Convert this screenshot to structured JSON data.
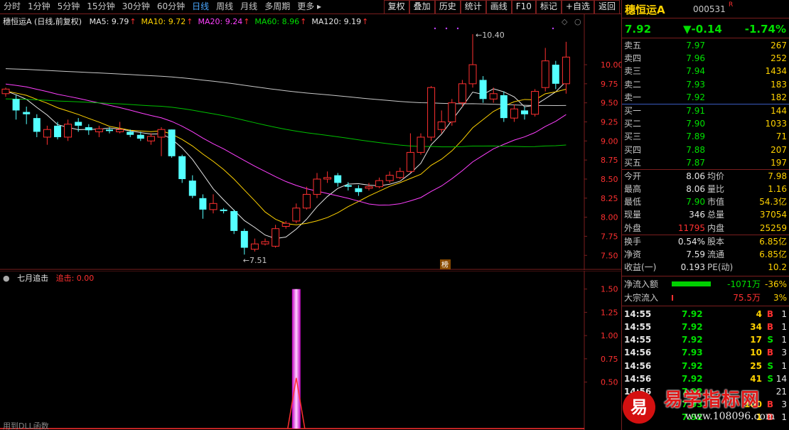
{
  "toolbar": {
    "periods": [
      "分时",
      "1分钟",
      "5分钟",
      "15分钟",
      "30分钟",
      "60分钟",
      "日线",
      "周线",
      "月线",
      "多周期",
      "更多"
    ],
    "active_period": "日线",
    "buttons": [
      "复权",
      "叠加",
      "历史",
      "统计",
      "画线",
      "F10",
      "标记",
      "+自选",
      "返回"
    ]
  },
  "main_legend": {
    "title": "穗恒运A (日线,前复权)",
    "ma": [
      {
        "label": "MA5: 9.79",
        "color": "#e6e6e6"
      },
      {
        "label": "MA10: 9.72",
        "color": "#ffd200"
      },
      {
        "label": "MA20: 9.24",
        "color": "#ff40ff"
      },
      {
        "label": "MA60: 8.96",
        "color": "#00e000"
      },
      {
        "label": "MA120: 9.19",
        "color": "#e6e6e6"
      }
    ]
  },
  "chart_data": [
    {
      "type": "candlestick",
      "y_ticks": [
        7.5,
        7.75,
        8.0,
        8.25,
        8.5,
        8.75,
        9.0,
        9.25,
        9.5,
        9.75,
        10.0
      ],
      "ylim": [
        7.4,
        10.55
      ],
      "annotations": [
        {
          "label": "10.40",
          "kind": "high"
        },
        {
          "label": "7.51",
          "kind": "low"
        },
        {
          "label": "榜",
          "kind": "event"
        }
      ],
      "candles": [
        {
          "o": 9.62,
          "c": 9.68,
          "h": 9.7,
          "l": 9.58
        },
        {
          "o": 9.55,
          "c": 9.4,
          "h": 9.6,
          "l": 9.28
        },
        {
          "o": 9.38,
          "c": 9.35,
          "h": 9.45,
          "l": 9.22
        },
        {
          "o": 9.3,
          "c": 9.12,
          "h": 9.35,
          "l": 9.05
        },
        {
          "o": 9.05,
          "c": 9.15,
          "h": 9.2,
          "l": 8.95
        },
        {
          "o": 9.2,
          "c": 9.05,
          "h": 9.25,
          "l": 9.02
        },
        {
          "o": 9.05,
          "c": 9.22,
          "h": 9.28,
          "l": 9.0
        },
        {
          "o": 9.25,
          "c": 9.2,
          "h": 9.3,
          "l": 9.12
        },
        {
          "o": 9.18,
          "c": 9.14,
          "h": 9.22,
          "l": 9.08
        },
        {
          "o": 9.12,
          "c": 9.16,
          "h": 9.2,
          "l": 9.05
        },
        {
          "o": 9.15,
          "c": 9.13,
          "h": 9.18,
          "l": 9.1
        },
        {
          "o": 9.12,
          "c": 9.15,
          "h": 9.25,
          "l": 9.1
        },
        {
          "o": 9.12,
          "c": 9.08,
          "h": 9.15,
          "l": 9.05
        },
        {
          "o": 9.08,
          "c": 9.03,
          "h": 9.12,
          "l": 9.0
        },
        {
          "o": 9.0,
          "c": 9.06,
          "h": 9.1,
          "l": 8.95
        },
        {
          "o": 9.05,
          "c": 9.15,
          "h": 9.18,
          "l": 8.8
        },
        {
          "o": 9.15,
          "c": 8.8,
          "h": 9.15,
          "l": 8.78
        },
        {
          "o": 8.8,
          "c": 8.5,
          "h": 8.82,
          "l": 8.45
        },
        {
          "o": 8.48,
          "c": 8.28,
          "h": 8.55,
          "l": 8.25
        },
        {
          "o": 8.25,
          "c": 8.1,
          "h": 8.3,
          "l": 7.98
        },
        {
          "o": 8.1,
          "c": 8.18,
          "h": 8.3,
          "l": 8.05
        },
        {
          "o": 8.1,
          "c": 8.08,
          "h": 8.12,
          "l": 8.05
        },
        {
          "o": 8.08,
          "c": 7.82,
          "h": 8.1,
          "l": 7.78
        },
        {
          "o": 7.82,
          "c": 7.6,
          "h": 7.85,
          "l": 7.51
        },
        {
          "o": 7.58,
          "c": 7.65,
          "h": 7.72,
          "l": 7.55
        },
        {
          "o": 7.65,
          "c": 7.68,
          "h": 7.72,
          "l": 7.63
        },
        {
          "o": 7.62,
          "c": 7.85,
          "h": 7.9,
          "l": 7.6
        },
        {
          "o": 7.88,
          "c": 7.92,
          "h": 7.95,
          "l": 7.85
        },
        {
          "o": 7.95,
          "c": 8.12,
          "h": 8.18,
          "l": 7.92
        },
        {
          "o": 8.12,
          "c": 8.3,
          "h": 8.4,
          "l": 8.1
        },
        {
          "o": 8.3,
          "c": 8.5,
          "h": 8.58,
          "l": 8.25
        },
        {
          "o": 8.5,
          "c": 8.52,
          "h": 8.6,
          "l": 8.45
        },
        {
          "o": 8.55,
          "c": 8.45,
          "h": 8.58,
          "l": 8.4
        },
        {
          "o": 8.42,
          "c": 8.4,
          "h": 8.46,
          "l": 8.35
        },
        {
          "o": 8.38,
          "c": 8.33,
          "h": 8.42,
          "l": 8.28
        },
        {
          "o": 8.38,
          "c": 8.4,
          "h": 8.45,
          "l": 8.35
        },
        {
          "o": 8.4,
          "c": 8.48,
          "h": 8.52,
          "l": 8.38
        },
        {
          "o": 8.48,
          "c": 8.55,
          "h": 8.6,
          "l": 8.45
        },
        {
          "o": 8.52,
          "c": 8.6,
          "h": 8.65,
          "l": 8.5
        },
        {
          "o": 8.6,
          "c": 8.85,
          "h": 9.1,
          "l": 8.58
        },
        {
          "o": 8.85,
          "c": 9.05,
          "h": 9.1,
          "l": 8.82
        },
        {
          "o": 9.05,
          "c": 9.7,
          "h": 9.72,
          "l": 9.0
        },
        {
          "o": 9.15,
          "c": 9.25,
          "h": 9.4,
          "l": 9.1
        },
        {
          "o": 9.25,
          "c": 9.5,
          "h": 9.55,
          "l": 9.2
        },
        {
          "o": 9.5,
          "c": 9.75,
          "h": 9.8,
          "l": 9.45
        },
        {
          "o": 9.75,
          "c": 10.0,
          "h": 10.4,
          "l": 9.7
        },
        {
          "o": 9.8,
          "c": 9.55,
          "h": 9.85,
          "l": 9.5
        },
        {
          "o": 9.55,
          "c": 9.62,
          "h": 9.7,
          "l": 9.5
        },
        {
          "o": 9.6,
          "c": 9.3,
          "h": 9.65,
          "l": 9.25
        },
        {
          "o": 9.3,
          "c": 9.42,
          "h": 9.48,
          "l": 9.25
        },
        {
          "o": 9.4,
          "c": 9.35,
          "h": 9.45,
          "l": 9.28
        },
        {
          "o": 9.35,
          "c": 9.65,
          "h": 9.68,
          "l": 9.32
        },
        {
          "o": 9.7,
          "c": 10.05,
          "h": 10.22,
          "l": 9.65
        },
        {
          "o": 10.0,
          "c": 9.75,
          "h": 10.05,
          "l": 9.68
        },
        {
          "o": 9.75,
          "c": 10.1,
          "h": 10.3,
          "l": 9.62
        }
      ]
    },
    {
      "type": "bar",
      "title": "七月追击",
      "y_ticks": [
        0.5,
        0.75,
        1.0,
        1.25,
        1.5
      ],
      "ylim": [
        0,
        1.62
      ],
      "signal_index": 28,
      "signal_value": 1.5
    }
  ],
  "sub_legend": {
    "name": "七月追击",
    "value_label": "追击: 0.00"
  },
  "sub_footer": "用到DLL函数",
  "stock": {
    "name": "穗恒运A",
    "code": "000531",
    "flag": "R"
  },
  "quote": {
    "price": "7.92",
    "change": "▼-0.14",
    "pct": "-1.74%"
  },
  "asks": [
    {
      "label": "卖五",
      "price": "7.97",
      "vol": "267"
    },
    {
      "label": "卖四",
      "price": "7.96",
      "vol": "252"
    },
    {
      "label": "卖三",
      "price": "7.94",
      "vol": "1434"
    },
    {
      "label": "卖二",
      "price": "7.93",
      "vol": "183"
    },
    {
      "label": "卖一",
      "price": "7.92",
      "vol": "182"
    }
  ],
  "bids": [
    {
      "label": "买一",
      "price": "7.91",
      "vol": "144"
    },
    {
      "label": "买二",
      "price": "7.90",
      "vol": "1033"
    },
    {
      "label": "买三",
      "price": "7.89",
      "vol": "71"
    },
    {
      "label": "买四",
      "price": "7.88",
      "vol": "207"
    },
    {
      "label": "买五",
      "price": "7.87",
      "vol": "197"
    }
  ],
  "stats1": [
    {
      "l1": "今开",
      "v1": "8.06",
      "c1": "w",
      "l2": "均价",
      "v2": "7.98",
      "c2": "g"
    },
    {
      "l1": "最高",
      "v1": "8.06",
      "c1": "w",
      "l2": "量比",
      "v2": "1.16",
      "c2": "r"
    },
    {
      "l1": "最低",
      "v1": "7.90",
      "c1": "g",
      "l2": "市值",
      "v2": "54.3亿",
      "c2": "w"
    },
    {
      "l1": "现量",
      "v1": "346",
      "c1": "w",
      "l2": "总量",
      "v2": "37054",
      "c2": "w"
    },
    {
      "l1": "外盘",
      "v1": "11795",
      "c1": "r",
      "l2": "内盘",
      "v2": "25259",
      "c2": "g"
    }
  ],
  "stats2": [
    {
      "l1": "换手",
      "v1": "0.54%",
      "c1": "w",
      "l2": "股本",
      "v2": "6.85亿",
      "c2": "w"
    },
    {
      "l1": "净资",
      "v1": "7.59",
      "c1": "w",
      "l2": "流通",
      "v2": "6.85亿",
      "c2": "w"
    },
    {
      "l1": "收益(一)",
      "v1": "0.193",
      "c1": "w",
      "l2": "PE(动)",
      "v2": "10.2",
      "c2": "w"
    }
  ],
  "flow": [
    {
      "label": "净流入额",
      "value": "-1071万",
      "pct": "-36%",
      "vc": "g"
    },
    {
      "label": "大宗流入",
      "value": "75.5万",
      "pct": "3%",
      "vc": "r"
    }
  ],
  "ticks": [
    {
      "t": "14:55",
      "p": "7.92",
      "q": "4",
      "d": "B",
      "n": "1"
    },
    {
      "t": "14:55",
      "p": "7.92",
      "q": "34",
      "d": "B",
      "n": "1"
    },
    {
      "t": "14:55",
      "p": "7.92",
      "q": "17",
      "d": "S",
      "n": "1"
    },
    {
      "t": "14:56",
      "p": "7.93",
      "q": "10",
      "d": "B",
      "n": "3"
    },
    {
      "t": "14:56",
      "p": "7.92",
      "q": "25",
      "d": "S",
      "n": "1"
    },
    {
      "t": "14:56",
      "p": "7.92",
      "q": "41",
      "d": "S",
      "n": "14"
    },
    {
      "t": "14:56",
      "p": "7.92",
      "q": "",
      "d": "",
      "n": "21"
    },
    {
      "t": "",
      "p": "7.93",
      "q": "100",
      "d": "B",
      "n": "3"
    },
    {
      "t": "",
      "p": "7.92",
      "q": "1",
      "d": "B",
      "n": "1"
    }
  ],
  "watermark": {
    "logo": "易",
    "text": "易学指标网",
    "url": "www.108096.com"
  }
}
